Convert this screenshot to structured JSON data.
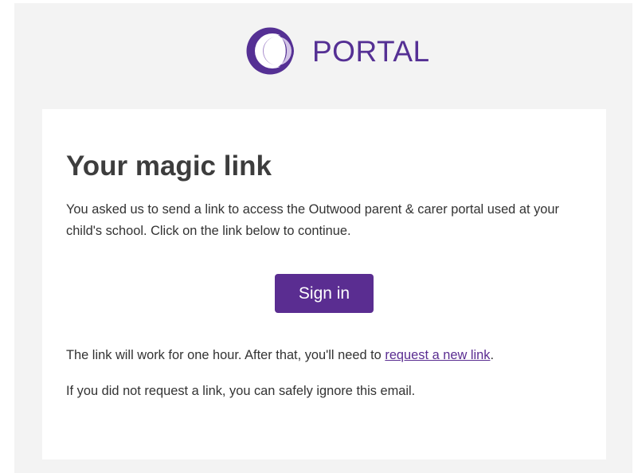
{
  "brand": {
    "name": "PORTAL",
    "logo_icon": "portal-ring-logo-icon",
    "color": "#553094"
  },
  "email": {
    "heading": "Your magic link",
    "intro": "You asked us to send a link to access the Outwood parent & carer portal used at your child's school. Click on the link below to continue.",
    "sign_in_label": "Sign in",
    "expiry_prefix": "The link will work for one hour. After that, you'll need to ",
    "expiry_link": "request a new link",
    "expiry_suffix": ".",
    "ignore_note": "If you did not request a link, you can safely ignore this email."
  },
  "colors": {
    "page_background": "#f3f3f3",
    "card_background": "#ffffff",
    "accent": "#5a2d91",
    "text": "#333333",
    "heading": "#3d3d3d"
  }
}
